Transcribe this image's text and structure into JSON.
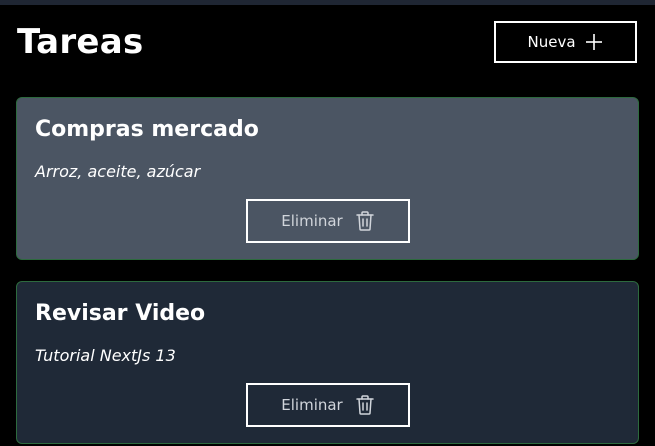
{
  "header": {
    "title": "Tareas",
    "new_button_label": "Nueva",
    "new_button_icon": "plus-icon"
  },
  "tasks": [
    {
      "title": "Compras mercado",
      "description": "Arroz, aceite, azúcar",
      "delete_label": "Eliminar",
      "delete_icon": "trash-icon",
      "background": "#4b5563"
    },
    {
      "title": "Revisar Video",
      "description": "Tutorial NextJs 13",
      "delete_label": "Eliminar",
      "delete_icon": "trash-icon",
      "background": "#1f2937"
    }
  ],
  "colors": {
    "page_background": "#000000",
    "card_border": "#2d6a3e",
    "text": "#ffffff"
  }
}
